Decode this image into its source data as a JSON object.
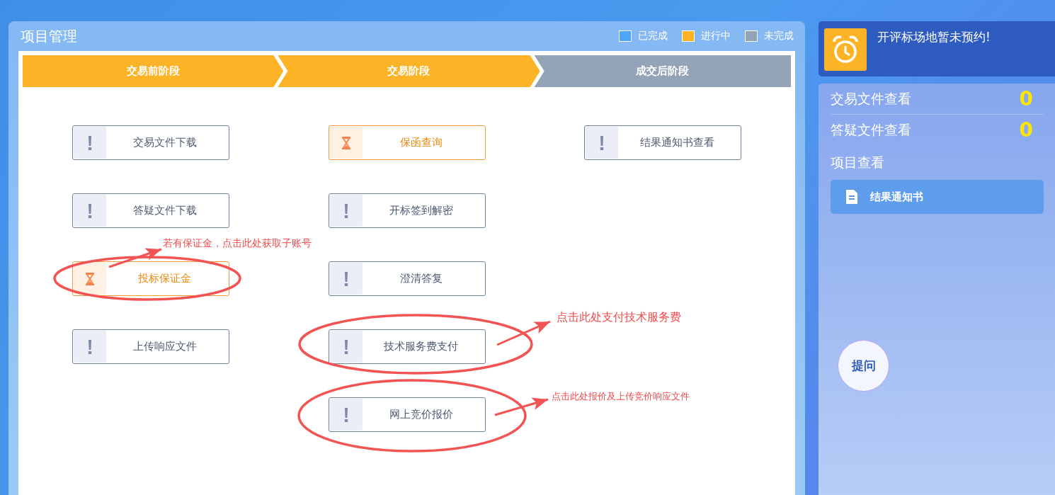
{
  "panel": {
    "title": "项目管理"
  },
  "legend": [
    {
      "label": "已完成",
      "color": "#4ca8f6"
    },
    {
      "label": "进行中",
      "color": "#fcb325"
    },
    {
      "label": "未完成",
      "color": "#93a3b8"
    }
  ],
  "stages": [
    {
      "label": "交易前阶段",
      "kind": "ongoing",
      "tasks": [
        {
          "label": "交易文件下载",
          "kind": "todo"
        },
        {
          "label": "答疑文件下载",
          "kind": "todo"
        },
        {
          "label": "投标保证金",
          "kind": "ongoing",
          "note": "若有保证金，点击此处获取子账号"
        },
        {
          "label": "上传响应文件",
          "kind": "todo"
        }
      ]
    },
    {
      "label": "交易阶段",
      "kind": "ongoing",
      "tasks": [
        {
          "label": "保函查询",
          "kind": "ongoing"
        },
        {
          "label": "开标签到解密",
          "kind": "todo"
        },
        {
          "label": "澄清答复",
          "kind": "todo"
        },
        {
          "label": "技术服务费支付",
          "kind": "todo",
          "note": "点击此处支付技术服务费"
        },
        {
          "label": "网上竞价报价",
          "kind": "todo",
          "note": "点击此处报价及上传竞价响应文件"
        }
      ]
    },
    {
      "label": "成交后阶段",
      "kind": "todo",
      "tasks": [
        {
          "label": "结果通知书查看",
          "kind": "todo"
        }
      ]
    }
  ],
  "alert": {
    "text": "开评标场地暂未预约!"
  },
  "counters": [
    {
      "label": "交易文件查看",
      "count": "0"
    },
    {
      "label": "答疑文件查看",
      "count": "0"
    }
  ],
  "project_view": {
    "heading": "项目查看",
    "button": "结果通知书"
  },
  "ask_button": "提问"
}
